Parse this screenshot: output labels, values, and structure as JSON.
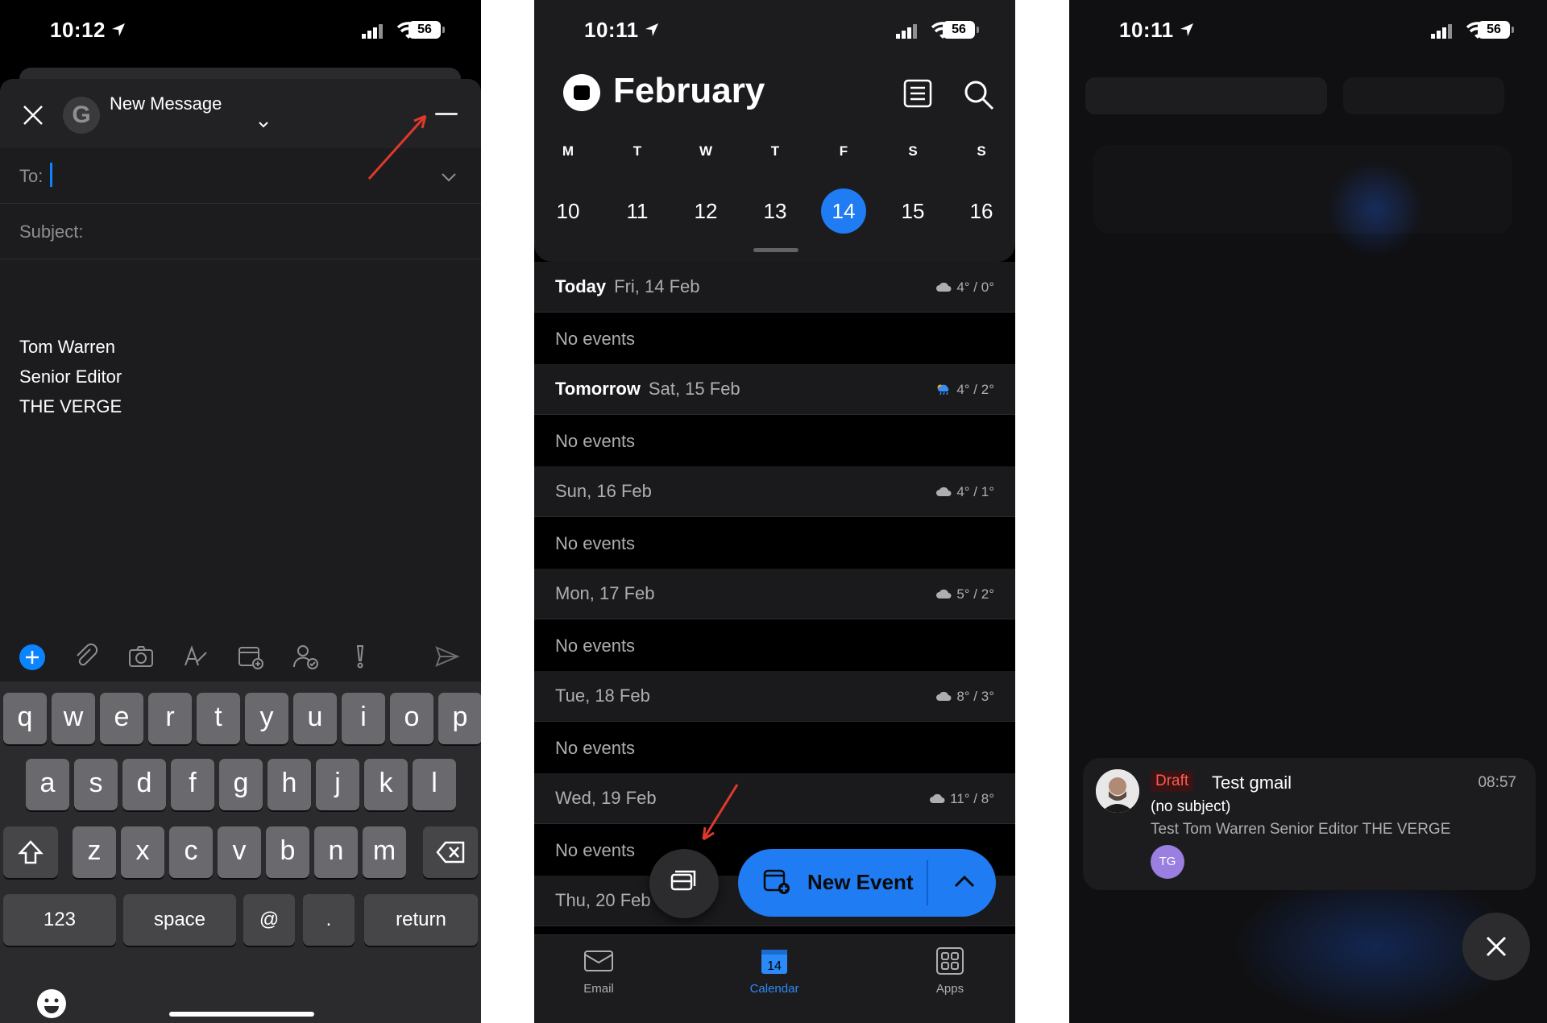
{
  "phone1": {
    "status": {
      "time": "10:12",
      "battery": "56"
    },
    "compose": {
      "account_initial": "G",
      "title": "New Message",
      "to_label": "To:",
      "subject_label": "Subject:",
      "signature": [
        "Tom Warren",
        "Senior Editor",
        "THE VERGE"
      ]
    },
    "keyboard": {
      "row1": [
        "q",
        "w",
        "e",
        "r",
        "t",
        "y",
        "u",
        "i",
        "o",
        "p"
      ],
      "row2": [
        "a",
        "s",
        "d",
        "f",
        "g",
        "h",
        "j",
        "k",
        "l"
      ],
      "row3": [
        "z",
        "x",
        "c",
        "v",
        "b",
        "n",
        "m"
      ],
      "numbers": "123",
      "space": "space",
      "at": "@",
      "dot": ".",
      "return": "return"
    }
  },
  "phone2": {
    "status": {
      "time": "10:11",
      "battery": "56"
    },
    "month": "February",
    "weekdays": [
      "M",
      "T",
      "W",
      "T",
      "F",
      "S",
      "S"
    ],
    "dates": [
      "10",
      "11",
      "12",
      "13",
      "14",
      "15",
      "16"
    ],
    "selected_date": "14",
    "agenda": [
      {
        "strong": "Today",
        "label": "Fri, 14 Feb",
        "weather": "4° / 0°",
        "icon": "cloud-icon",
        "events": "No events"
      },
      {
        "strong": "Tomorrow",
        "label": "Sat, 15 Feb",
        "weather": "4° / 2°",
        "icon": "rain-sun-icon",
        "events": "No events"
      },
      {
        "strong": "",
        "label": "Sun, 16 Feb",
        "weather": "4° / 1°",
        "icon": "cloud-icon",
        "events": "No events"
      },
      {
        "strong": "",
        "label": "Mon, 17 Feb",
        "weather": "5° / 2°",
        "icon": "cloud-icon",
        "events": "No events"
      },
      {
        "strong": "",
        "label": "Tue, 18 Feb",
        "weather": "8° / 3°",
        "icon": "cloud-icon",
        "events": "No events"
      },
      {
        "strong": "",
        "label": "Wed, 19 Feb",
        "weather": "11° / 8°",
        "icon": "cloud-icon",
        "events": "No events"
      },
      {
        "strong": "",
        "label": "Thu, 20 Feb",
        "weather": "",
        "icon": "",
        "events": ""
      }
    ],
    "new_event_label": "New Event",
    "tabs": [
      {
        "label": "Email",
        "icon": "envelope-icon"
      },
      {
        "label": "Calendar",
        "icon": "calendar-icon",
        "badge": "14"
      },
      {
        "label": "Apps",
        "icon": "apps-grid-icon"
      }
    ],
    "accent": "#1f7cf2"
  },
  "phone3": {
    "status": {
      "time": "10:11",
      "battery": "56"
    },
    "notification": {
      "tag": "Draft",
      "title": "Test gmail",
      "time": "08:57",
      "subject": "(no subject)",
      "body": "Test Tom Warren Senior Editor THE VERGE",
      "initials": "TG"
    }
  }
}
